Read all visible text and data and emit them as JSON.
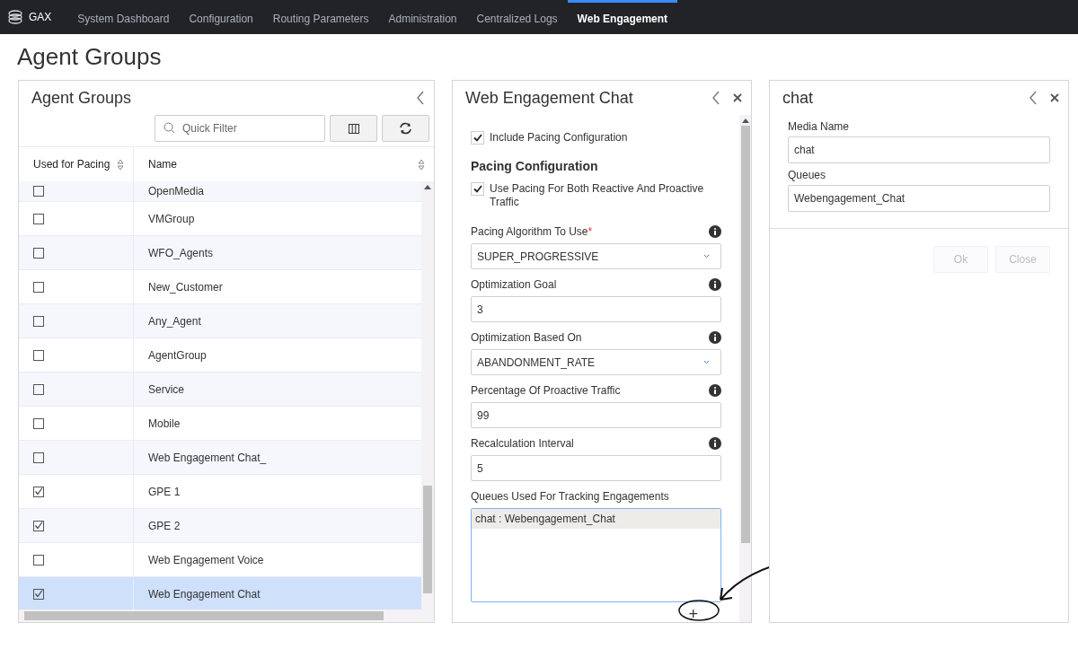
{
  "nav": {
    "brand": "GAX",
    "items": [
      {
        "label": "System Dashboard",
        "selected": false
      },
      {
        "label": "Configuration",
        "selected": false
      },
      {
        "label": "Routing Parameters",
        "selected": false
      },
      {
        "label": "Administration",
        "selected": false
      },
      {
        "label": "Centralized Logs",
        "selected": false
      },
      {
        "label": "Web Engagement",
        "selected": true
      }
    ]
  },
  "page_title": "Agent Groups",
  "list_panel": {
    "title": "Agent Groups",
    "search": {
      "placeholder": "Quick Filter"
    },
    "columns": [
      "Used for Pacing",
      "Name"
    ],
    "rows": [
      {
        "name": "OpenMedia",
        "checked": false,
        "selected": false
      },
      {
        "name": "VMGroup",
        "checked": false,
        "selected": false
      },
      {
        "name": "WFO_Agents",
        "checked": false,
        "selected": false
      },
      {
        "name": "New_Customer",
        "checked": false,
        "selected": false
      },
      {
        "name": "Any_Agent",
        "checked": false,
        "selected": false
      },
      {
        "name": "AgentGroup",
        "checked": false,
        "selected": false
      },
      {
        "name": "Service",
        "checked": false,
        "selected": false
      },
      {
        "name": "Mobile",
        "checked": false,
        "selected": false
      },
      {
        "name": "Web Engagement Chat_",
        "checked": false,
        "selected": false
      },
      {
        "name": "GPE 1",
        "checked": true,
        "selected": false
      },
      {
        "name": "GPE 2",
        "checked": true,
        "selected": false
      },
      {
        "name": "Web Engagement Voice",
        "checked": false,
        "selected": false
      },
      {
        "name": "Web Engagement Chat",
        "checked": true,
        "selected": true
      }
    ]
  },
  "detail_panel": {
    "title": "Web Engagement Chat",
    "include_pacing": {
      "label": "Include Pacing Configuration",
      "checked": true
    },
    "section_title": "Pacing Configuration",
    "use_pacing_both": {
      "label": "Use Pacing For Both Reactive And Proactive Traffic",
      "checked": true
    },
    "fields": [
      {
        "kind": "select",
        "label": "Pacing Algorithm To Use",
        "required": true,
        "value": "SUPER_PROGRESSIVE"
      },
      {
        "kind": "input",
        "label": "Optimization Goal",
        "required": false,
        "value": "3"
      },
      {
        "kind": "select",
        "label": "Optimization Based On",
        "required": false,
        "value": "ABANDONMENT_RATE"
      },
      {
        "kind": "input",
        "label": "Percentage Of Proactive Traffic",
        "required": false,
        "value": "99"
      },
      {
        "kind": "input",
        "label": "Recalculation Interval",
        "required": false,
        "value": "5"
      }
    ],
    "required_mark": "*",
    "queues": {
      "label": "Queues Used For Tracking Engagements",
      "items": [
        "chat : Webengagement_Chat"
      ]
    },
    "add_button": "+"
  },
  "media_panel": {
    "title": "chat",
    "fields": [
      {
        "label": "Media Name",
        "value": "chat"
      },
      {
        "label": "Queues",
        "value": "Webengagement_Chat"
      }
    ],
    "buttons": [
      {
        "label": "Ok",
        "disabled": true
      },
      {
        "label": "Close",
        "disabled": true
      }
    ]
  }
}
